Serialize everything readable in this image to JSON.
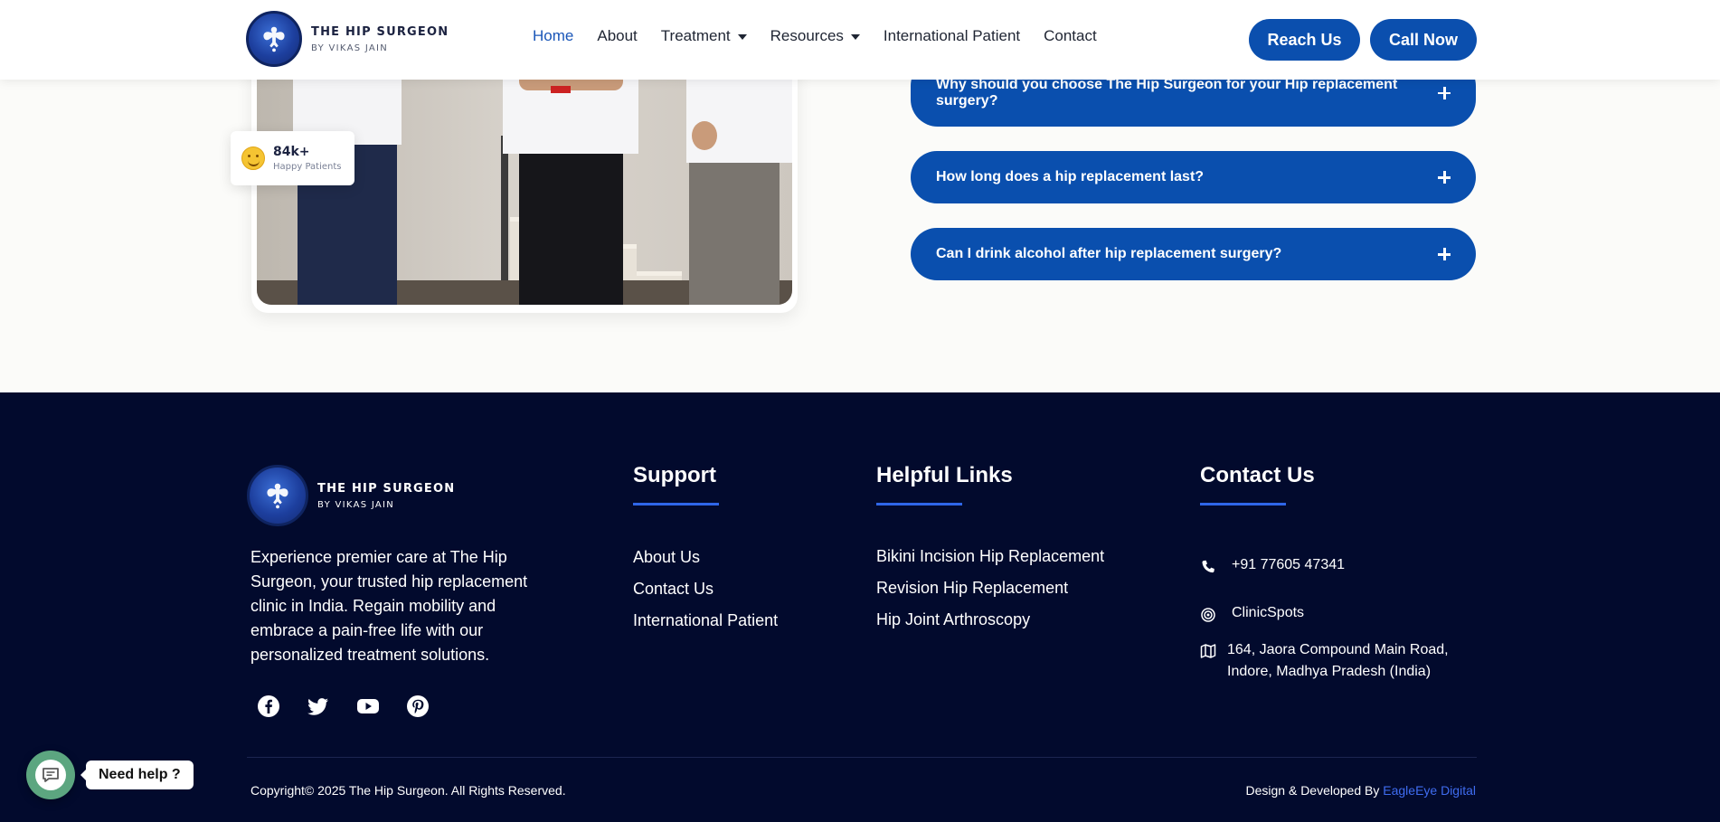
{
  "header": {
    "brand_title": "THE HIP SURGEON",
    "brand_sub": "BY VIKAS JAIN",
    "nav": [
      {
        "label": "Home",
        "active": true,
        "dropdown": false
      },
      {
        "label": "About",
        "active": false,
        "dropdown": false
      },
      {
        "label": "Treatment",
        "active": false,
        "dropdown": true
      },
      {
        "label": "Resources",
        "active": false,
        "dropdown": true
      },
      {
        "label": "International Patient",
        "active": false,
        "dropdown": false
      },
      {
        "label": "Contact",
        "active": false,
        "dropdown": false
      }
    ],
    "reach_us": "Reach Us",
    "call_now": "Call Now"
  },
  "hero": {
    "stat_number": "84k+",
    "stat_label": "Happy Patients"
  },
  "faq": [
    {
      "question": "Why should you choose The Hip Surgeon for your Hip replacement surgery?"
    },
    {
      "question": "How long does a hip replacement last?"
    },
    {
      "question": "Can I drink alcohol after hip replacement surgery?"
    }
  ],
  "footer": {
    "brand_title": "THE HIP SURGEON",
    "brand_sub": "BY VIKAS JAIN",
    "description": "Experience premier care at The Hip Surgeon, your trusted hip replacement clinic in India. Regain mobility and embrace a pain-free life with our personalized treatment solutions.",
    "socials": [
      "facebook-icon",
      "twitter-icon",
      "youtube-icon",
      "pinterest-icon"
    ],
    "support": {
      "title": "Support",
      "links": [
        "About Us",
        "Contact Us",
        "International Patient"
      ]
    },
    "helpful": {
      "title": "Helpful Links",
      "links": [
        "Bikini Incision Hip Replacement",
        "Revision Hip Replacement",
        "Hip Joint Arthroscopy"
      ]
    },
    "contact": {
      "title": "Contact Us",
      "phone": "+91 77605 47341",
      "clinic": "ClinicSpots",
      "address_line1": "164, Jaora Compound Main Road,",
      "address_line2": "Indore, Madhya Pradesh (India)"
    },
    "copyright": "Copyright© 2025 The Hip Surgeon. All Rights Reserved.",
    "credit_prefix": "Design & Developed By ",
    "credit_link": "EagleEye Digital"
  },
  "chat": {
    "tooltip": "Need help ?"
  },
  "colors": {
    "primary": "#0a4fae",
    "footer_bg": "#020a2d",
    "accent_bar": "#2f66e8",
    "credit_link": "#3f6cf0",
    "chat_green": "#5ca680"
  }
}
